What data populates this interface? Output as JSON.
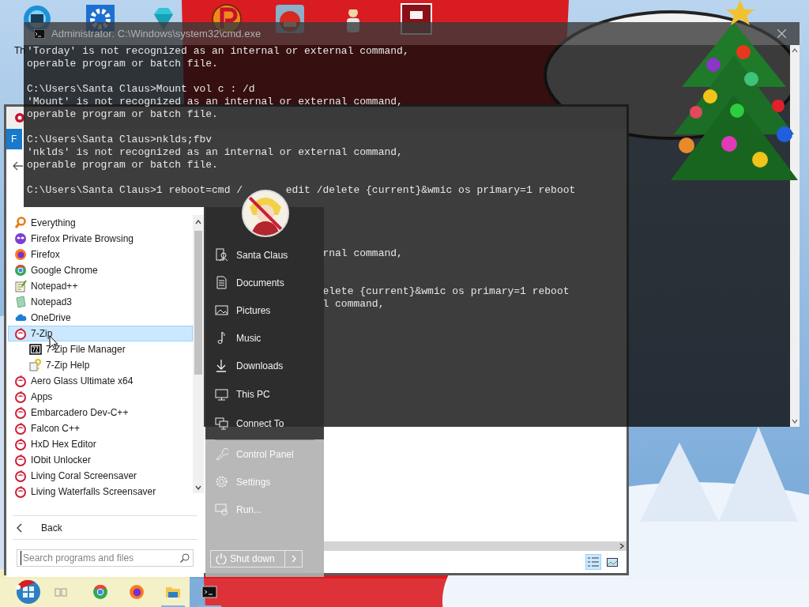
{
  "desktop_icons": [
    {
      "kind": "globe",
      "label": "Th"
    },
    {
      "kind": "gear"
    },
    {
      "kind": "gem"
    },
    {
      "kind": "p-logo"
    },
    {
      "kind": "bird"
    },
    {
      "kind": "figure"
    },
    {
      "kind": "red-app"
    }
  ],
  "explorer": {
    "ribbon_tabs": [
      {
        "kind": "file",
        "label": "F"
      }
    ]
  },
  "cmd": {
    "title": "Administrator: C:\\Windows\\system32\\cmd.exe",
    "lines": [
      {
        "kind": "full",
        "text": "'Torday' is not recognized as an internal or external command,"
      },
      {
        "kind": "full",
        "text": "operable program or batch file."
      },
      {
        "kind": "blank"
      },
      {
        "kind": "full",
        "text": "C:\\Users\\Santa Claus>Mount vol c : /d"
      },
      {
        "kind": "full",
        "text": "'Mount' is not recognized as an internal or external command,"
      },
      {
        "kind": "full",
        "text": "operable program or batch file."
      },
      {
        "kind": "blank"
      },
      {
        "kind": "full",
        "text": "C:\\Users\\Santa Claus>nklds;fbv"
      },
      {
        "kind": "full",
        "text": "'nklds' is not recognized as an internal or external command,"
      },
      {
        "kind": "full",
        "text": "operable program or batch file."
      },
      {
        "kind": "blank"
      },
      {
        "kind": "split",
        "text": "C:\\Users\\Santa Claus>1 reboot=cmd /",
        "text_after": "edit /delete {current}&wmic os primary=1 reboot"
      },
      {
        "kind": "blank"
      },
      {
        "kind": "blank"
      },
      {
        "kind": "blank"
      },
      {
        "kind": "blank"
      },
      {
        "kind": "tail",
        "text": "rnal command,"
      },
      {
        "kind": "blank"
      },
      {
        "kind": "blank"
      },
      {
        "kind": "tail",
        "text": "elete {current}&wmic os primary=1 reboot"
      },
      {
        "kind": "tail",
        "text": "l command,"
      }
    ]
  },
  "start_menu": {
    "programs": [
      {
        "kind": "magnifier",
        "label": "Everything",
        "selected": false
      },
      {
        "kind": "mask",
        "label": "Firefox Private Browsing",
        "selected": false
      },
      {
        "kind": "firefox",
        "label": "Firefox",
        "selected": false
      },
      {
        "kind": "chrome",
        "label": "Google Chrome",
        "selected": false
      },
      {
        "kind": "notepad",
        "label": "Notepad++",
        "selected": false
      },
      {
        "kind": "notepad3",
        "label": "Notepad3",
        "selected": false
      },
      {
        "kind": "cloud",
        "label": "OneDrive",
        "selected": false
      },
      {
        "kind": "folder",
        "label": "7-Zip",
        "selected": true,
        "children": [
          {
            "kind": "sevenzip",
            "label": "7-Zip File Manager",
            "selected": false
          },
          {
            "kind": "help",
            "label": "7-Zip Help",
            "selected": false
          }
        ]
      },
      {
        "kind": "folder",
        "label": "Aero Glass Ultimate x64",
        "selected": false
      },
      {
        "kind": "folder",
        "label": "Apps",
        "selected": false
      },
      {
        "kind": "folder",
        "label": "Embarcadero Dev-C++",
        "selected": false
      },
      {
        "kind": "folder",
        "label": "Falcon C++",
        "selected": false
      },
      {
        "kind": "folder",
        "label": "HxD Hex Editor",
        "selected": false
      },
      {
        "kind": "folder",
        "label": "IObit Unlocker",
        "selected": false
      },
      {
        "kind": "folder",
        "label": "Living Coral Screensaver",
        "selected": false
      },
      {
        "kind": "folder",
        "label": "Living Waterfalls Screensaver",
        "selected": false
      }
    ],
    "back": "Back",
    "search": {
      "placeholder": "Search programs and files"
    },
    "places": [
      {
        "kind": "user",
        "label": "Santa Claus"
      },
      {
        "kind": "documents",
        "label": "Documents"
      },
      {
        "kind": "pictures",
        "label": "Pictures"
      },
      {
        "kind": "music",
        "label": "Music"
      },
      {
        "kind": "downloads",
        "label": "Downloads"
      },
      {
        "kind": "pc",
        "label": "This PC"
      },
      {
        "kind": "connect",
        "label": "Connect To"
      }
    ],
    "system": [
      {
        "kind": "wrench",
        "label": "Control Panel"
      },
      {
        "kind": "gear",
        "label": "Settings"
      },
      {
        "kind": "run",
        "label": "Run..."
      }
    ],
    "shutdown": "Shut down"
  },
  "taskbar": [
    {
      "kind": "start",
      "running": false
    },
    {
      "kind": "task-view",
      "running": false
    },
    {
      "kind": "chrome",
      "running": false
    },
    {
      "kind": "firefox",
      "running": false
    },
    {
      "kind": "explorer",
      "running": true
    },
    {
      "kind": "cmd",
      "running": true
    }
  ]
}
